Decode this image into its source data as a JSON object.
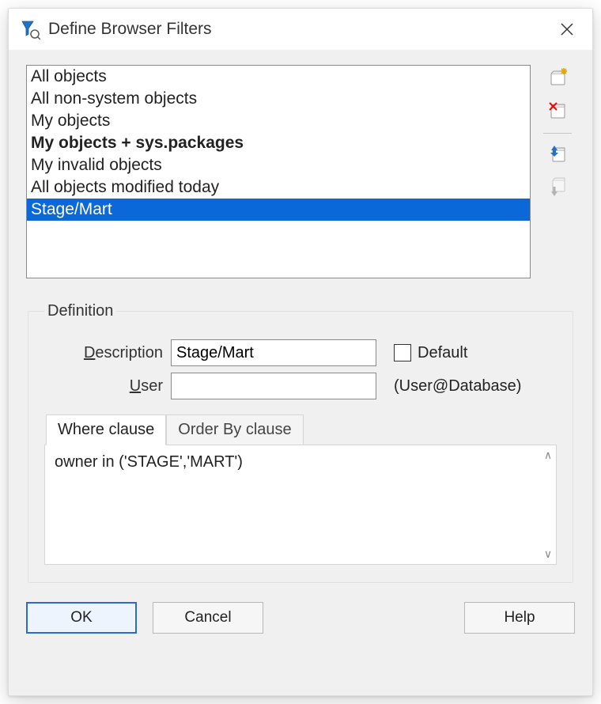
{
  "window": {
    "title": "Define Browser Filters"
  },
  "filters": {
    "items": [
      {
        "label": "All objects",
        "bold": false,
        "selected": false
      },
      {
        "label": "All non-system objects",
        "bold": false,
        "selected": false
      },
      {
        "label": "My objects",
        "bold": false,
        "selected": false
      },
      {
        "label": "My objects + sys.packages",
        "bold": true,
        "selected": false
      },
      {
        "label": "My invalid objects",
        "bold": false,
        "selected": false
      },
      {
        "label": "All objects modified today",
        "bold": false,
        "selected": false
      },
      {
        "label": "Stage/Mart",
        "bold": false,
        "selected": true
      }
    ]
  },
  "toolbar": {
    "new_name": "new-filter-button",
    "delete_name": "delete-filter-button",
    "move_up_name": "move-up-button",
    "move_down_name": "move-down-button",
    "move_down_disabled": true
  },
  "definition": {
    "legend": "Definition",
    "description_label_pre": "D",
    "description_label_post": "escription",
    "description_value": "Stage/Mart",
    "default_label": "Default",
    "default_checked": false,
    "user_label_pre": "U",
    "user_label_post": "ser",
    "user_value": "",
    "user_hint": "(User@Database)",
    "tabs": [
      {
        "label": "Where clause",
        "active": true
      },
      {
        "label": "Order By clause",
        "active": false
      }
    ],
    "where_text": "owner in ('STAGE','MART')"
  },
  "buttons": {
    "ok": "OK",
    "cancel": "Cancel",
    "help": "Help"
  }
}
